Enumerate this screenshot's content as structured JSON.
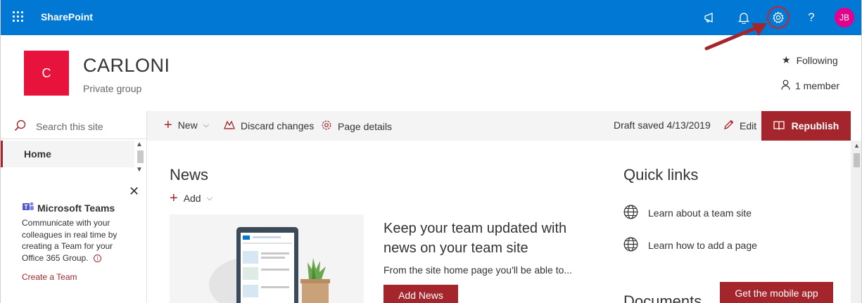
{
  "suite_bar": {
    "app_name": "SharePoint",
    "avatar_initials": "JB",
    "help_glyph": "?"
  },
  "site": {
    "logo_letter": "C",
    "title": "CARLONI",
    "subtitle": "Private group",
    "follow_label": "Following",
    "members_label": "1 member"
  },
  "left_nav": {
    "search_placeholder": "Search this site",
    "items": [
      {
        "label": "Home"
      }
    ],
    "teams_promo": {
      "title": "Microsoft Teams",
      "description": "Communicate with your colleagues in real time by creating a Team for your Office 365 Group.",
      "link": "Create a Team"
    }
  },
  "command_bar": {
    "new_label": "New",
    "discard_label": "Discard changes",
    "page_details_label": "Page details",
    "status": "Draft saved 4/13/2019",
    "edit_label": "Edit",
    "republish_label": "Republish"
  },
  "news": {
    "title": "News",
    "add_label": "Add",
    "heading": "Keep your team updated with news on your team site",
    "body": "From the site home page you'll be able to...",
    "button": "Add News"
  },
  "quick_links": {
    "title": "Quick links",
    "items": [
      {
        "label": "Learn about a team site"
      },
      {
        "label": "Learn how to add a page"
      }
    ]
  },
  "documents": {
    "title": "Documents",
    "mobile_button": "Get the mobile app"
  },
  "colors": {
    "suite_bar": "#0078d4",
    "accent": "#a4262c",
    "site_logo": "#e8133d",
    "avatar": "#e3008c",
    "annotation": "#c4262e"
  }
}
